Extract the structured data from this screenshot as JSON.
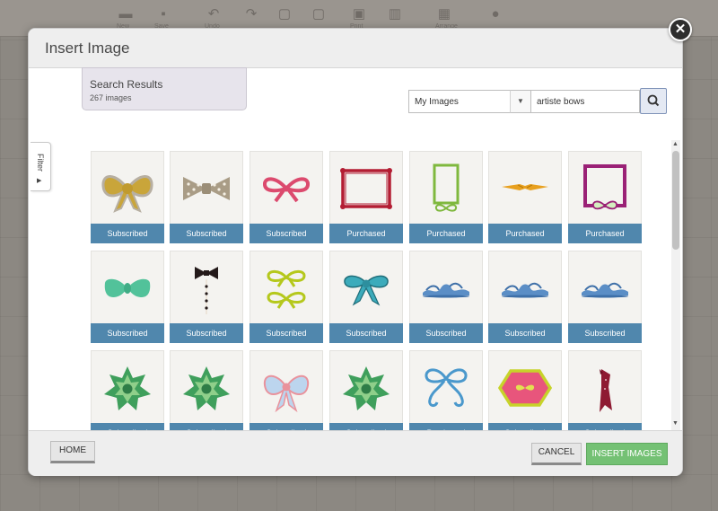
{
  "toolbar": {
    "icons": [
      "folder-icon",
      "save-icon",
      "undo-icon",
      "redo-icon",
      "group-icon",
      "ungroup-icon",
      "image-frame-icon",
      "layers-icon",
      "grid-icon",
      "circle-icon"
    ],
    "labels": [
      "New",
      "Save",
      "Undo",
      "",
      "",
      "",
      "Print",
      "",
      "Arrange",
      ""
    ]
  },
  "dialog": {
    "title": "Insert Image",
    "results": {
      "title": "Search Results",
      "count": "267 images"
    },
    "source_select": {
      "value": "My Images"
    },
    "search": {
      "value": "artiste bows"
    },
    "filter_label": "Filter",
    "grid": {
      "tiles": [
        {
          "label": "Subscribed",
          "icon": "gold-bow-icon"
        },
        {
          "label": "Subscribed",
          "icon": "polka-dot-bowtie-icon"
        },
        {
          "label": "Subscribed",
          "icon": "pink-ribbon-bow-icon"
        },
        {
          "label": "Purchased",
          "icon": "red-frame-icon"
        },
        {
          "label": "Purchased",
          "icon": "green-bow-frame-icon"
        },
        {
          "label": "Purchased",
          "icon": "orange-ribbon-icon"
        },
        {
          "label": "Purchased",
          "icon": "purple-bow-frame-icon"
        },
        {
          "label": "Subscribed",
          "icon": "teal-bowtie-icon"
        },
        {
          "label": "Subscribed",
          "icon": "tuxedo-bowtie-icon"
        },
        {
          "label": "Subscribed",
          "icon": "lime-double-bow-icon"
        },
        {
          "label": "Subscribed",
          "icon": "teal-ribbon-bow-icon"
        },
        {
          "label": "Subscribed",
          "icon": "blue-swirl-icon"
        },
        {
          "label": "Subscribed",
          "icon": "blue-swirl-icon"
        },
        {
          "label": "Subscribed",
          "icon": "blue-swirl-icon"
        },
        {
          "label": "Subscribed",
          "icon": "green-gift-bow-icon"
        },
        {
          "label": "Subscribed",
          "icon": "green-gift-bow-icon"
        },
        {
          "label": "Subscribed",
          "icon": "pastel-bow-icon"
        },
        {
          "label": "Subscribed",
          "icon": "green-gift-bow-icon"
        },
        {
          "label": "Purchased",
          "icon": "blue-curly-bow-icon"
        },
        {
          "label": "Subscribed",
          "icon": "pink-hexagon-bow-icon"
        },
        {
          "label": "Subscribed",
          "icon": "maroon-ribbon-icon"
        }
      ]
    },
    "buttons": {
      "home": "HOME",
      "cancel": "CANCEL",
      "insert": "INSERT IMAGES"
    }
  }
}
